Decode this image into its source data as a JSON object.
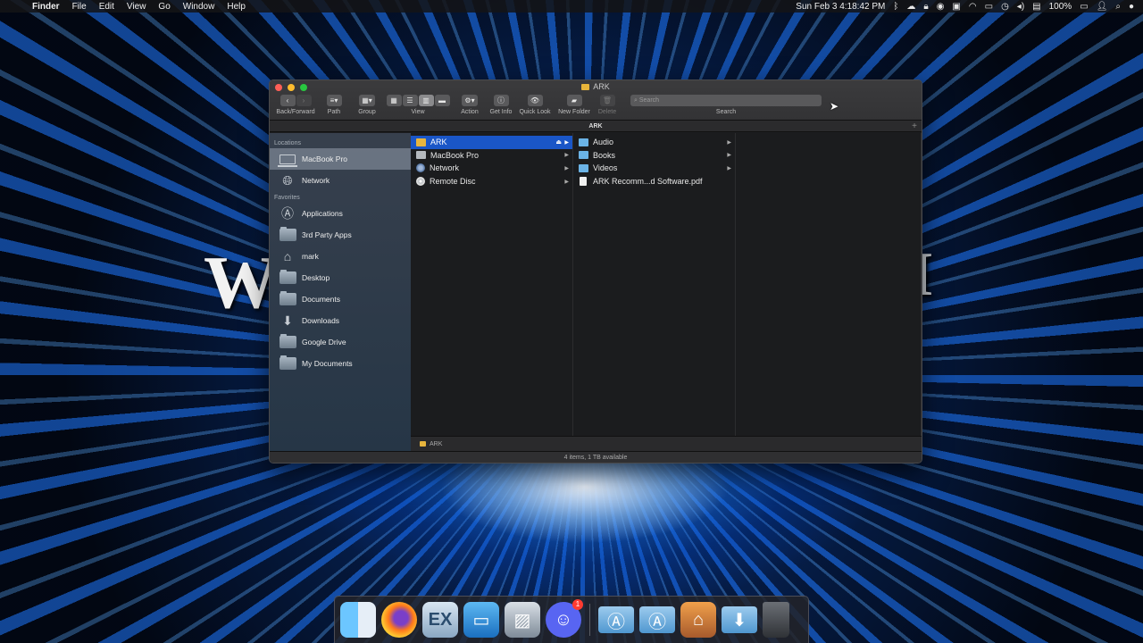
{
  "menubar": {
    "app_name": "Finder",
    "items": [
      "File",
      "Edit",
      "View",
      "Go",
      "Window",
      "Help"
    ],
    "clock": "Sun Feb 3  4:18:42 PM",
    "battery": "100%",
    "status_icons": [
      "bluetooth-icon",
      "cloud-icon",
      "lock-icon",
      "dropbox-icon",
      "display-icon",
      "wifi-icon",
      "airplay-icon",
      "time-machine-icon",
      "volume-icon",
      "battery-icon",
      "user-icon",
      "spotlight-icon",
      "siri-icon"
    ]
  },
  "wallpaper": {
    "text_left": "W",
    "text_right": "I"
  },
  "window": {
    "title": "ARK",
    "toolbar": {
      "back_forward": "Back/Forward",
      "path": "Path",
      "group": "Group",
      "view": "View",
      "action": "Action",
      "get_info": "Get Info",
      "quick_look": "Quick Look",
      "new_folder": "New Folder",
      "delete": "Delete",
      "search_placeholder": "Search",
      "search_label": "Search"
    },
    "path_title": "ARK",
    "sidebar": {
      "locations_heading": "Locations",
      "locations": [
        {
          "label": "MacBook Pro",
          "icon": "laptop-icon"
        },
        {
          "label": "Network",
          "icon": "network-icon"
        }
      ],
      "favorites_heading": "Favorites",
      "favorites": [
        {
          "label": "Applications",
          "icon": "applications-icon"
        },
        {
          "label": "3rd Party Apps",
          "icon": "folder-icon"
        },
        {
          "label": "mark",
          "icon": "home-icon"
        },
        {
          "label": "Desktop",
          "icon": "desktop-icon"
        },
        {
          "label": "Documents",
          "icon": "documents-icon"
        },
        {
          "label": "Downloads",
          "icon": "downloads-icon"
        },
        {
          "label": "Google Drive",
          "icon": "folder-icon"
        },
        {
          "label": "My Documents",
          "icon": "folder-icon"
        }
      ]
    },
    "column1": [
      {
        "label": "ARK"
      },
      {
        "label": "MacBook Pro"
      },
      {
        "label": "Network"
      },
      {
        "label": "Remote Disc"
      }
    ],
    "column2": [
      {
        "label": "Audio"
      },
      {
        "label": "Books"
      },
      {
        "label": "Videos"
      },
      {
        "label": "ARK Recomm...d Software.pdf"
      }
    ],
    "footer_path": "ARK",
    "status": "4 items, 1 TB available"
  },
  "dock": {
    "apps": [
      "finder-icon",
      "firefox-icon",
      "ex-icon",
      "keynote-icon",
      "preview-icon",
      "discord-icon"
    ],
    "discord_badge": "1",
    "ex_label": "EX",
    "stacks": [
      "applications-folder-icon",
      "documents-folder-icon",
      "home-folder-icon",
      "downloads-folder-icon",
      "trash-icon"
    ]
  }
}
